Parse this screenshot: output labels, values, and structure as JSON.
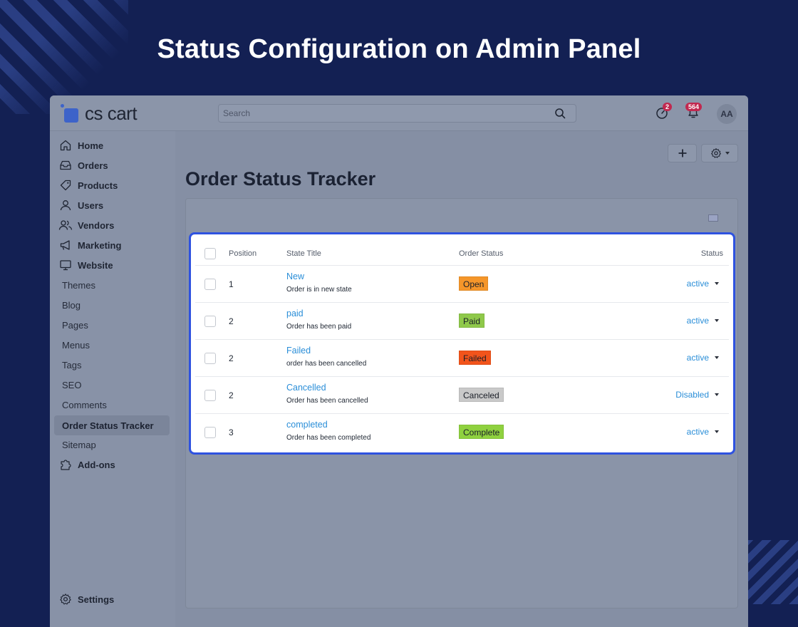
{
  "hero": {
    "title": "Status Configuration on Admin Panel"
  },
  "topbar": {
    "logo_text": "cs cart",
    "search_placeholder": "Search",
    "help_badge": "2",
    "notifications_badge": "564",
    "avatar": "AA"
  },
  "sidebar": {
    "items": [
      {
        "label": "Home",
        "icon": "home-icon"
      },
      {
        "label": "Orders",
        "icon": "inbox-icon"
      },
      {
        "label": "Products",
        "icon": "tag-icon"
      },
      {
        "label": "Users",
        "icon": "user-icon"
      },
      {
        "label": "Vendors",
        "icon": "users-icon"
      },
      {
        "label": "Marketing",
        "icon": "megaphone-icon"
      },
      {
        "label": "Website",
        "icon": "monitor-icon"
      }
    ],
    "subitems": [
      "Themes",
      "Blog",
      "Pages",
      "Menus",
      "Tags",
      "SEO",
      "Comments",
      "Order Status Tracker",
      "Sitemap"
    ],
    "active_subitem": "Order Status Tracker",
    "addons": {
      "label": "Add-ons",
      "icon": "puzzle-icon"
    },
    "settings": {
      "label": "Settings",
      "icon": "gear-icon"
    }
  },
  "page": {
    "title": "Order Status Tracker"
  },
  "table": {
    "headers": {
      "position": "Position",
      "state_title": "State Title",
      "order_status": "Order Status",
      "status": "Status"
    },
    "rows": [
      {
        "position": "1",
        "title": "New",
        "description": "Order is in new state",
        "order_status": "Open",
        "badge_color": "#f5962a",
        "status": "active"
      },
      {
        "position": "2",
        "title": "paid",
        "description": "Order has been paid",
        "order_status": "Paid",
        "badge_color": "#8fc94a",
        "status": "active"
      },
      {
        "position": "2",
        "title": "Failed",
        "description": "order has been cancelled",
        "order_status": "Failed",
        "badge_color": "#f2541b",
        "status": "active"
      },
      {
        "position": "2",
        "title": "Cancelled",
        "description": "Order has been cancelled",
        "order_status": "Canceled",
        "badge_color": "#c9c9c9",
        "status": "Disabled"
      },
      {
        "position": "3",
        "title": "completed",
        "description": "Order has been completed",
        "order_status": "Complete",
        "badge_color": "#8fd13f",
        "status": "active"
      }
    ]
  },
  "colors": {
    "accent": "#2e52e0",
    "link": "#2a8ed8",
    "background": "#132053"
  }
}
